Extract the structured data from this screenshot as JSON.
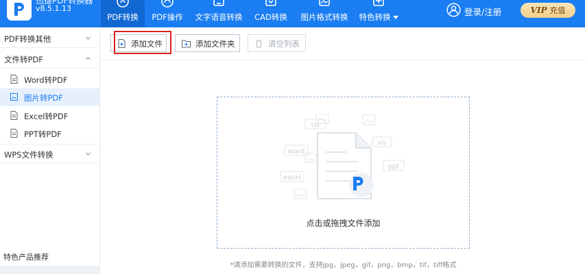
{
  "app": {
    "title": "迅捷PDF转换器",
    "version": "v8.5.1.13"
  },
  "nav": {
    "tabs": [
      {
        "label": "PDF转换",
        "icon": "pdf-convert-icon"
      },
      {
        "label": "PDF操作",
        "icon": "pdf-operate-icon"
      },
      {
        "label": "文字语音转换",
        "icon": "text-speech-icon"
      },
      {
        "label": "CAD转换",
        "icon": "cad-icon"
      },
      {
        "label": "图片格式转换",
        "icon": "image-format-icon"
      },
      {
        "label": "特色转换",
        "icon": "featured-icon"
      }
    ],
    "active_tab": 0
  },
  "user": {
    "login_label": "登录/注册",
    "vip_mark": "VIP",
    "vip_label": "充值"
  },
  "sidebar": {
    "groups": [
      {
        "label": "PDF转换其他",
        "expanded": false
      },
      {
        "label": "文件转PDF",
        "expanded": true
      },
      {
        "label": "WPS文件转换",
        "expanded": false
      }
    ],
    "items": [
      {
        "label": "Word转PDF",
        "icon": "document-icon"
      },
      {
        "label": "图片转PDF",
        "icon": "image-icon"
      },
      {
        "label": "Excel转PDF",
        "icon": "document-icon"
      },
      {
        "label": "PPT转PDF",
        "icon": "document-icon"
      }
    ],
    "active_item": 1,
    "footer_title": "特色产品推荐"
  },
  "toolbar": {
    "add_file": "添加文件",
    "add_folder": "添加文件夹",
    "clear_list": "清空列表"
  },
  "dropzone": {
    "prompt": "点击或拖拽文件添加",
    "format_labels": [
      "txt",
      "word",
      "xls",
      "ppt",
      "excel"
    ]
  },
  "hint": "*请添加需要转换的文件，支持jpg，jpeg，gif，png，bmp，tif，tiff格式",
  "colors": {
    "brand": "#1a7df1",
    "brand_dark": "#1268d3",
    "highlight": "#d92121",
    "vip_gold": "#f1cf88"
  }
}
